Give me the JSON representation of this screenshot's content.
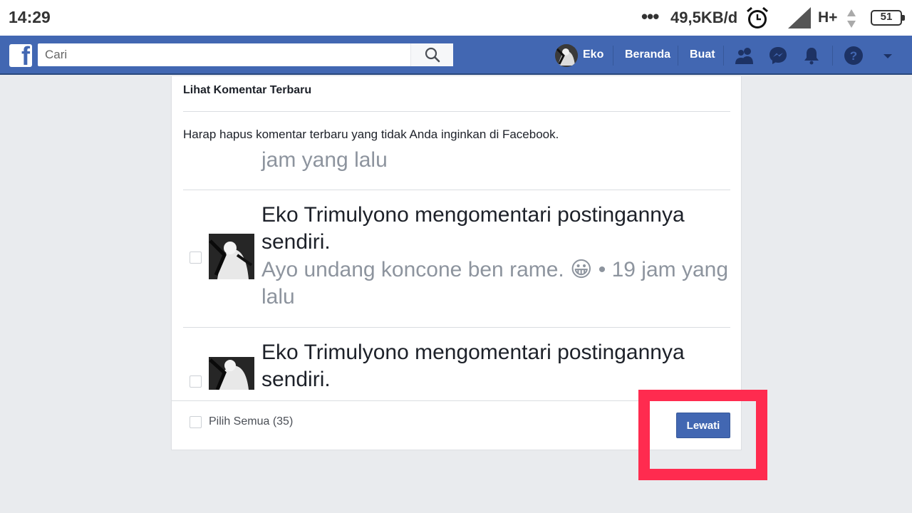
{
  "status_bar": {
    "time": "14:29",
    "dots": "•••",
    "speed": "49,5KB/d",
    "network": "H+",
    "battery": "51",
    "icons": [
      "alarm-clock-icon",
      "signal-icon",
      "data-arrows-icon",
      "battery-icon"
    ]
  },
  "header": {
    "logo": "f",
    "search_placeholder": "Cari",
    "user_name": "Eko",
    "nav_home": "Beranda",
    "nav_create": "Buat",
    "icons": [
      "friends-icon",
      "messenger-icon",
      "notifications-icon",
      "help-icon",
      "dropdown-caret-icon"
    ],
    "brand_color": "#4267b2"
  },
  "card": {
    "title": "Lihat Komentar Terbaru",
    "description": "Harap hapus komentar terbaru yang tidak Anda inginkan di Facebook.",
    "partial_top": "jam yang lalu",
    "items": [
      {
        "headline": "Eko Trimulyono mengomentari postingannya sendiri.",
        "comment": "Ayo undang koncone ben rame.",
        "emoji": "😀",
        "time": "• 19 jam yang lalu"
      },
      {
        "headline": "Eko Trimulyono mengomentari postingannya sendiri."
      }
    ],
    "select_all_label": "Pilih Semua (35)",
    "skip_button": "Lewati"
  },
  "annotation": {
    "highlight_color": "#ff2b4f"
  }
}
